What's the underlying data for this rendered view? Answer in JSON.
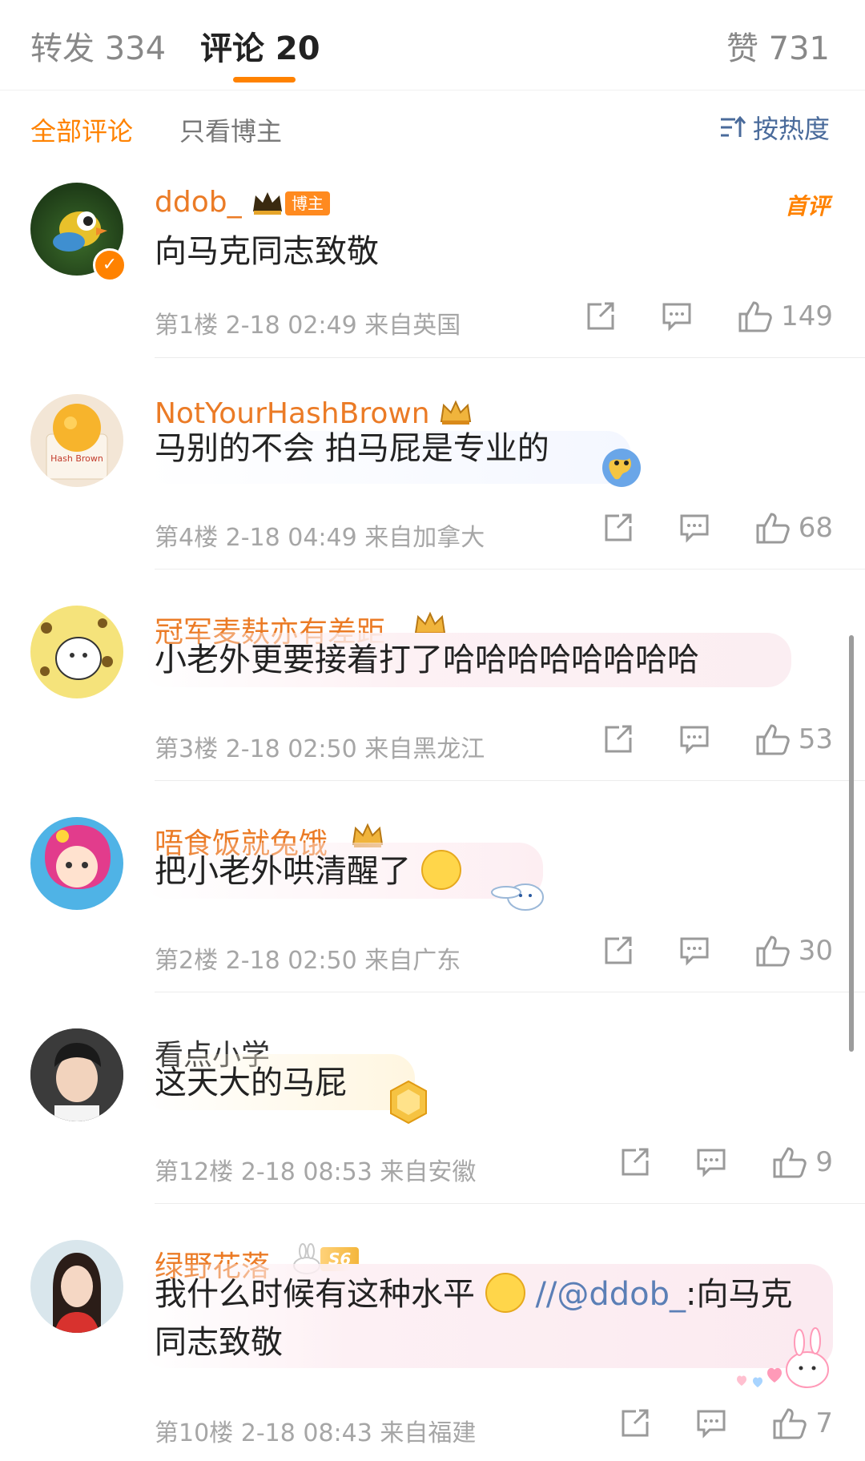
{
  "tabs": {
    "repost": "转发 334",
    "comments": "评论 20",
    "likes": "赞 731"
  },
  "filters": {
    "all": "全部评论",
    "author_only": "只看博主",
    "sort": "按热度"
  },
  "colors": {
    "accent": "#ff8200",
    "username": "#eb7b26",
    "link": "#5b7fb6",
    "meta": "#a6a6a6"
  },
  "comments": [
    {
      "username": "ddob_",
      "author_tag": "博主",
      "first_tag": "首评",
      "text": "向马克同志致敬",
      "floor": "第1楼",
      "time": "2-18 02:49",
      "location": "来自英国",
      "likes": "149"
    },
    {
      "username": "NotYourHashBrown",
      "text": "马别的不会 拍马屁是专业的",
      "floor": "第4楼",
      "time": "2-18 04:49",
      "location": "来自加拿大",
      "likes": "68"
    },
    {
      "username": "冠军麦麸亦有差距",
      "text": "小老外更要接着打了哈哈哈哈哈哈哈哈",
      "floor": "第3楼",
      "time": "2-18 02:50",
      "location": "来自黑龙江",
      "likes": "53"
    },
    {
      "username": "唔食饭就兔饿",
      "text": "把小老外哄清醒了",
      "floor": "第2楼",
      "time": "2-18 02:50",
      "location": "来自广东",
      "likes": "30"
    },
    {
      "username": "看点小学",
      "text": "这天大的马屁",
      "floor": "第12楼",
      "time": "2-18 08:53",
      "location": "来自安徽",
      "likes": "9"
    },
    {
      "username": "绿野花落",
      "level": "S6",
      "text_line1": "我什么时候有这种水平",
      "mention": "//@ddob_",
      "text_line1_tail": ":向马克",
      "text_line2": "同志致敬",
      "floor": "第10楼",
      "time": "2-18 08:43",
      "location": "来自福建",
      "likes": "7"
    }
  ]
}
